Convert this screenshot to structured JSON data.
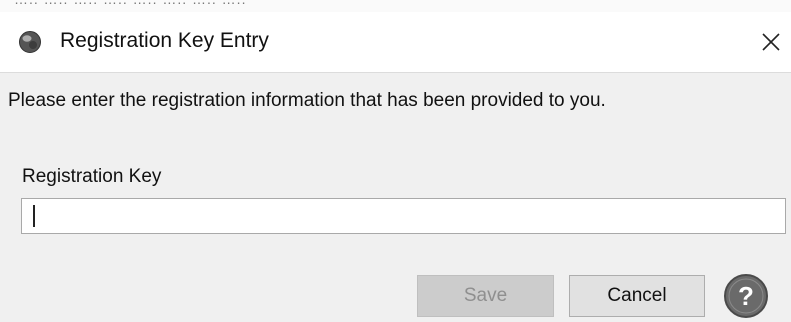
{
  "background_text": "….. ….. ….. ….. ….. ….. ….. …..",
  "dialog": {
    "title": "Registration Key Entry",
    "instructions": "Please enter the registration information that has been provided to you.",
    "field_label": "Registration Key",
    "field_value": "",
    "save_label": "Save",
    "cancel_label": "Cancel",
    "close_glyph": "✕",
    "help_glyph": "?",
    "save_enabled": false
  },
  "colors": {
    "title_bg": "#ffffff",
    "body_bg": "#f0f0f0",
    "save_disabled_bg": "#cccccc",
    "save_disabled_text": "#8f8f8f",
    "cancel_bg": "#e1e1e1",
    "help_icon": "#5a5a5a"
  },
  "icons": {
    "app": "app-logo-icon",
    "close": "close-icon",
    "help": "help-icon"
  }
}
